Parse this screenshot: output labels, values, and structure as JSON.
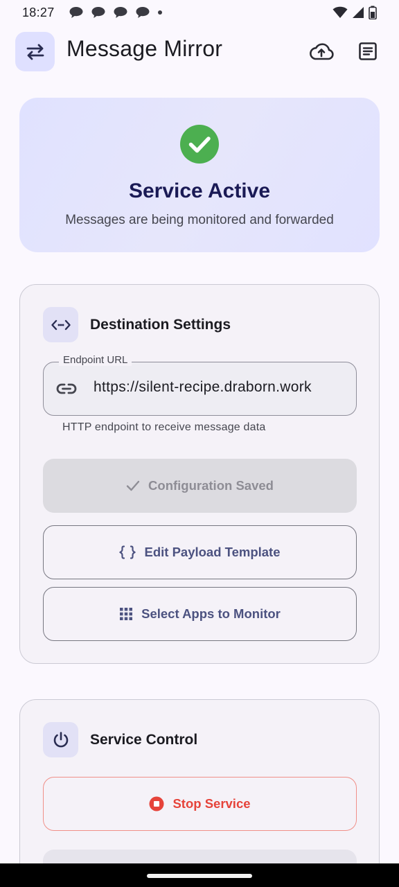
{
  "status_bar": {
    "time": "18:27",
    "notification_icons": [
      "chat-bubble-icon",
      "chat-bubble-icon",
      "chat-bubble-icon",
      "chat-bubble-icon",
      "dot-icon"
    ],
    "right_icons": [
      "wifi-icon",
      "signal-icon",
      "battery-icon"
    ]
  },
  "app_bar": {
    "title": "Message Mirror",
    "logo_icon": "swap-arrows-icon",
    "actions": [
      "cloud-upload-icon",
      "logs-document-icon"
    ]
  },
  "status_card": {
    "title": "Service Active",
    "subtitle": "Messages are being monitored and forwarded",
    "icon": "check-circle-icon",
    "icon_color": "#4caf50"
  },
  "destination_settings": {
    "title": "Destination Settings",
    "icon": "code-icon",
    "endpoint": {
      "label": "Endpoint URL",
      "value": "https://silent-recipe.draborn.work",
      "helper": "HTTP endpoint to receive message data",
      "icon": "link-icon"
    },
    "save_button": {
      "label": "Configuration Saved",
      "icon": "check-icon",
      "enabled": false
    },
    "template_button": {
      "label": "Edit Payload Template",
      "icon": "braces-icon"
    },
    "apps_button": {
      "label": "Select Apps to Monitor",
      "icon": "grid-icon"
    }
  },
  "service_control": {
    "title": "Service Control",
    "icon": "power-icon",
    "stop_button": {
      "label": "Stop Service",
      "icon": "stop-circle-icon",
      "color": "#e6433a"
    }
  },
  "colors": {
    "background": "#fbf8fe",
    "accent": "#4c5280",
    "hero_background": "#e0e2ff",
    "hero_title": "#1a1a55",
    "danger": "#e6433a"
  }
}
